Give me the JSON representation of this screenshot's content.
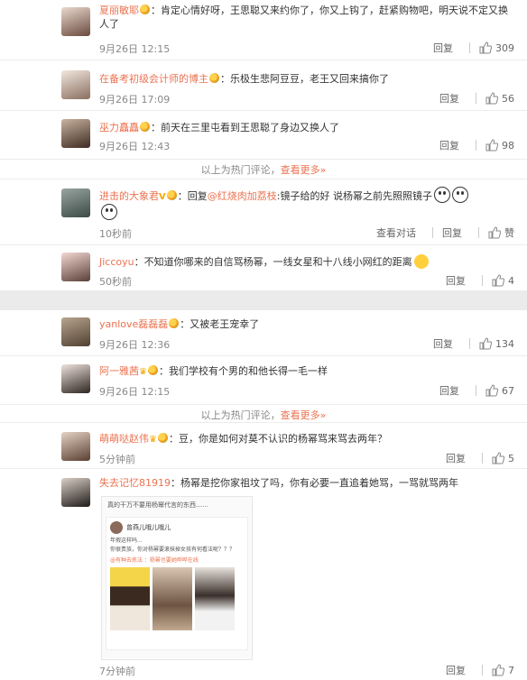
{
  "top": {
    "comments": [
      {
        "user": "夏丽敏耶",
        "text": "：肯定心情好呀，王思聪又来约你了，你又上钩了，赶紧购物吧，明天说不定又换人了",
        "time": "9月26日 12:15",
        "reply": "回复",
        "likes": "309"
      },
      {
        "user": "在备考初级会计师的博主",
        "text": "：乐极生悲阿豆豆，老王又回来搞你了",
        "time": "9月26日 17:09",
        "reply": "回复",
        "likes": "56"
      },
      {
        "user": "巫力矗矗",
        "text": "：前天在三里屯看到王思聪了身边又换人了",
        "time": "9月26日 12:43",
        "reply": "回复",
        "likes": "98"
      }
    ],
    "hot_text": "以上为热门评论，",
    "hot_more": "查看更多»",
    "latest": [
      {
        "user": "进击的大象君",
        "prefix": "：回复",
        "mention": "@红烧肉加荔枝",
        "text": ":镜子给的好 说杨幂之前先照照镜子",
        "time": "10秒前",
        "view": "查看对话",
        "reply": "回复",
        "likes": "赞"
      },
      {
        "user": "Jiccoyu",
        "text": "：不知道你哪来的自信骂杨幂，一线女星和十八线小网红的距离",
        "time": "50秒前",
        "reply": "回复",
        "likes": "4"
      }
    ]
  },
  "bottom": {
    "comments": [
      {
        "user": "yanlove磊磊磊",
        "text": "：又被老王宠幸了",
        "time": "9月26日 12:36",
        "reply": "回复",
        "likes": "134"
      },
      {
        "user": "阿一雅茜",
        "text": "：我们学校有个男的和他长得一毛一样",
        "time": "9月26日 12:15",
        "reply": "回复",
        "likes": "67"
      }
    ],
    "hot_text": "以上为热门评论，",
    "hot_more": "查看更多»",
    "latest": [
      {
        "user": "萌萌哒赵伟",
        "text": "：豆，你是如何对莫不认识的杨幂骂来骂去两年？",
        "time": "5分钟前",
        "reply": "回复",
        "likes": "5"
      },
      {
        "user": "失去记忆81919",
        "text": "：杨幂是挖你家祖坟了吗，你有必要一直追着她骂，一骂就骂两年",
        "time": "7分钟前",
        "reply": "回复",
        "likes": "7"
      }
    ],
    "embed": {
      "header": "真的干万不要用杨幂代言的东西……",
      "poster": "曾燕儿哦儿哦儿",
      "quote": "年假这样吗...",
      "reply": "你很贵族，你对杨幂要滚抹掉女孩有何看法呢？？？",
      "footer": "@有种去炼法 ：杨幂也要她哗哗在线"
    }
  },
  "colors": {
    "username": "#eb7350",
    "time": "#888888",
    "divider": "#ebebeb"
  }
}
